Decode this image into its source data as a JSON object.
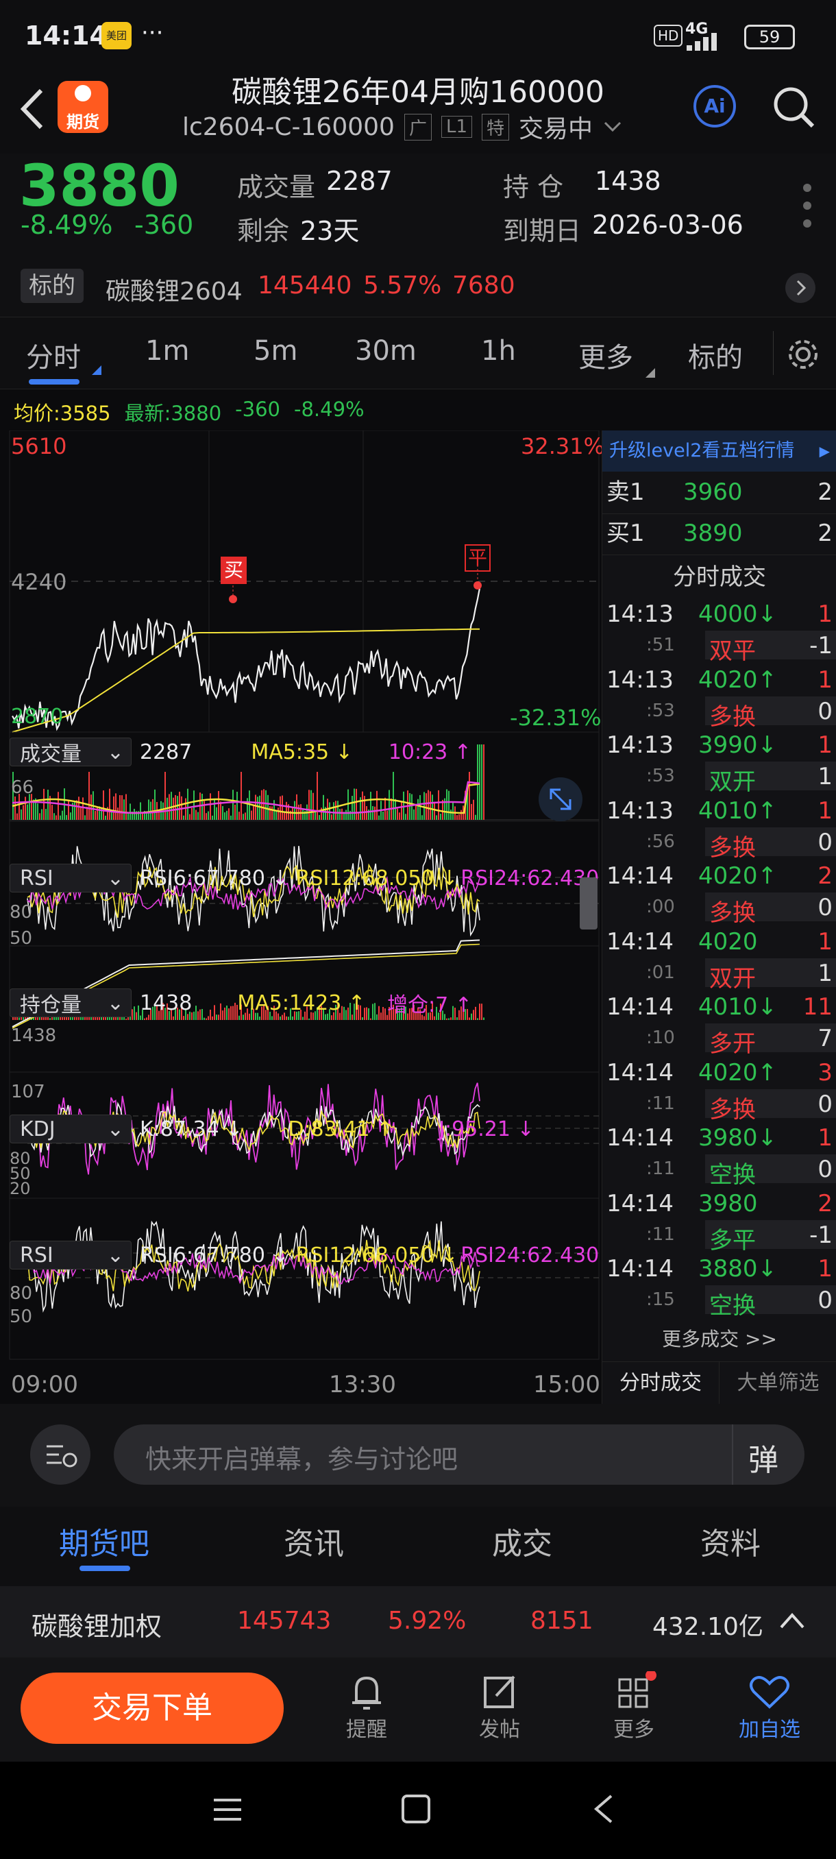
{
  "status": {
    "time": "14:14",
    "app_badge": "美团",
    "more": "···",
    "hd": "HD",
    "net": "4G",
    "battery": "59"
  },
  "header": {
    "title": "碳酸锂26年04月购160000",
    "code": "lc2604-C-160000",
    "tag1": "广",
    "tag2": "L1",
    "tag3": "特",
    "trade_status": "交易中",
    "logo_text": "期货",
    "ai": "Ai"
  },
  "quote": {
    "price": "3880",
    "change_pct": "-8.49%",
    "change": "-360",
    "volume_label": "成交量",
    "volume": "2287",
    "oi_label": "持 仓",
    "oi": "1438",
    "remain_label": "剩余",
    "remain": "23天",
    "expiry_label": "到期日",
    "expiry": "2026-03-06",
    "underlying_label": "标的",
    "underlying_name": "碳酸锂2604",
    "underlying_price": "145440",
    "underlying_pct": "5.57%",
    "underlying_change": "7680"
  },
  "tabs": [
    "分时",
    "1m",
    "5m",
    "30m",
    "1h",
    "更多",
    "标的"
  ],
  "chart_info": {
    "avg": "均价:3585",
    "latest": "最新:3880",
    "chg": "-360",
    "pct": "-8.49%"
  },
  "main_chart": {
    "y_top": "5610",
    "y_mid": "4240",
    "y_bottom": "2870",
    "pct_top": "32.31%",
    "pct_bottom": "-32.31%",
    "buy_marker": "买",
    "flat_marker": "平"
  },
  "vol_panel": {
    "select": "成交量",
    "value": "2287",
    "ma5": "MA5:35 ↓",
    "time": "10:23 ↑",
    "max": "66"
  },
  "rsi_panel": {
    "select": "RSI",
    "rsi6": "RSI6:67.780 ↓",
    "rsi12": "RSI12:68.050 ↓",
    "rsi24": "RSI24:62.430 ↓",
    "l80": "80",
    "l50": "50"
  },
  "oi_panel": {
    "select": "持仓量",
    "value": "1438",
    "ma5": "MA5:1423 ↑",
    "add": "增仓:7 ↑",
    "top": "1438",
    "bottom": "107"
  },
  "kdj_panel": {
    "select": "KDJ",
    "k": "K:87.34 ↓",
    "d": "D:83.41 ↑",
    "j": "J:95.21 ↓",
    "l80": "80",
    "l50": "50",
    "l20": "20"
  },
  "rsi_panel2": {
    "select": "RSI",
    "rsi6": "RSI6:67.780 ↓",
    "rsi12": "RSI12:68.050 ↓",
    "rsi24": "RSI24:62.430 ↓",
    "l80": "80",
    "l50": "50"
  },
  "time_axis": {
    "start": "09:00",
    "mid": "13:30",
    "end": "15:00"
  },
  "trade_panel": {
    "upgrade": "升级level2看五档行情",
    "sell1_label": "卖1",
    "sell1_price": "3960",
    "sell1_qty": "2",
    "buy1_label": "买1",
    "buy1_price": "3890",
    "buy1_qty": "2",
    "section_title": "分时成交",
    "trades": [
      {
        "time": "14:13",
        "sec": ":51",
        "price": "4000↓",
        "qty": "1",
        "type": "双平",
        "oi": "-1",
        "pcolor": "green",
        "tcolor": "red"
      },
      {
        "time": "14:13",
        "sec": ":53",
        "price": "4020↑",
        "qty": "1",
        "type": "多换",
        "oi": "0",
        "pcolor": "green",
        "tcolor": "red"
      },
      {
        "time": "14:13",
        "sec": ":53",
        "price": "3990↓",
        "qty": "1",
        "type": "双开",
        "oi": "1",
        "pcolor": "green",
        "tcolor": "green"
      },
      {
        "time": "14:13",
        "sec": ":56",
        "price": "4010↑",
        "qty": "1",
        "type": "多换",
        "oi": "0",
        "pcolor": "green",
        "tcolor": "red"
      },
      {
        "time": "14:14",
        "sec": ":00",
        "price": "4020↑",
        "qty": "2",
        "type": "多换",
        "oi": "0",
        "pcolor": "green",
        "tcolor": "red"
      },
      {
        "time": "14:14",
        "sec": ":01",
        "price": "4020",
        "qty": "1",
        "type": "双开",
        "oi": "1",
        "pcolor": "green",
        "tcolor": "red"
      },
      {
        "time": "14:14",
        "sec": ":10",
        "price": "4010↓",
        "qty": "11",
        "type": "多开",
        "oi": "7",
        "pcolor": "green",
        "tcolor": "red"
      },
      {
        "time": "14:14",
        "sec": ":11",
        "price": "4020↑",
        "qty": "3",
        "type": "多换",
        "oi": "0",
        "pcolor": "green",
        "tcolor": "red"
      },
      {
        "time": "14:14",
        "sec": ":11",
        "price": "3980↓",
        "qty": "1",
        "type": "空换",
        "oi": "0",
        "pcolor": "green",
        "tcolor": "green"
      },
      {
        "time": "14:14",
        "sec": ":11",
        "price": "3980",
        "qty": "2",
        "type": "多平",
        "oi": "-1",
        "pcolor": "green",
        "tcolor": "green"
      },
      {
        "time": "14:14",
        "sec": ":15",
        "price": "3880↓",
        "qty": "1",
        "type": "空换",
        "oi": "0",
        "pcolor": "green",
        "tcolor": "green"
      }
    ],
    "more_trades": "更多成交 >>",
    "tab1": "分时成交",
    "tab2": "大单筛选"
  },
  "comment": {
    "placeholder": "快来开启弹幕，参与讨论吧",
    "danmu": "弹"
  },
  "bottom_tabs": [
    "期货吧",
    "资讯",
    "成交",
    "资料"
  ],
  "weighted": {
    "name": "碳酸锂加权",
    "price": "145743",
    "pct": "5.92%",
    "chg": "8151",
    "amount": "432.10亿"
  },
  "actions": {
    "order": "交易下单",
    "alert": "提醒",
    "post": "发帖",
    "more": "更多",
    "watch": "加自选"
  },
  "colors": {
    "up": "#f03c3c",
    "down": "#2fc152",
    "accent": "#ff5a1f",
    "blue": "#4a8cff",
    "avg_line": "#f2e23a"
  }
}
